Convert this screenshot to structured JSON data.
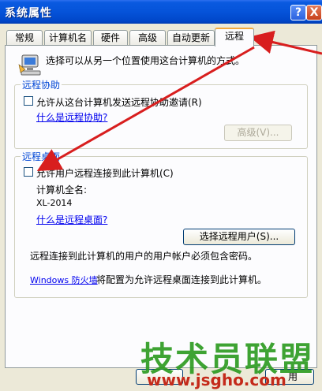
{
  "window": {
    "title": "系统属性",
    "help_glyph": "?",
    "close_glyph": "X"
  },
  "tabs": [
    {
      "label": "常规"
    },
    {
      "label": "计算机名"
    },
    {
      "label": "硬件"
    },
    {
      "label": "高级"
    },
    {
      "label": "自动更新"
    },
    {
      "label": "远程"
    }
  ],
  "active_tab": "远程",
  "intro_text": "选择可以从另一个位置使用这台计算机的方式。",
  "remote_assistance": {
    "group_label": "远程协助",
    "checkbox_label": "允许从这台计算机发送远程协助邀请(R)",
    "checked": false,
    "help_link": "什么是远程协助?",
    "advanced_button": "高级(V)..."
  },
  "remote_desktop": {
    "group_label": "远程桌面",
    "checkbox_label": "允许用户远程连接到此计算机(C)",
    "checked": false,
    "computer_full_name_label": "计算机全名:",
    "computer_full_name": "XL-2014",
    "help_link": "什么是远程桌面?",
    "select_users_button": "选择远程用户(S)...",
    "password_note": "远程连接到此计算机的用户的用户帐户必须包含密码。",
    "firewall_link": "Windows 防火墙",
    "firewall_text": "将配置为允许远程桌面连接到此计算机。"
  },
  "bottom_buttons_partial": [
    "",
    "用"
  ],
  "watermark": {
    "title": "技术员联盟",
    "url": "www.jsgho.com"
  },
  "colors": {
    "titlebar": "#0553d9",
    "arrow": "#d81e1e",
    "link": "#0000ee",
    "group_label": "#0046d5",
    "active_tab_accent": "#f3a93c"
  }
}
